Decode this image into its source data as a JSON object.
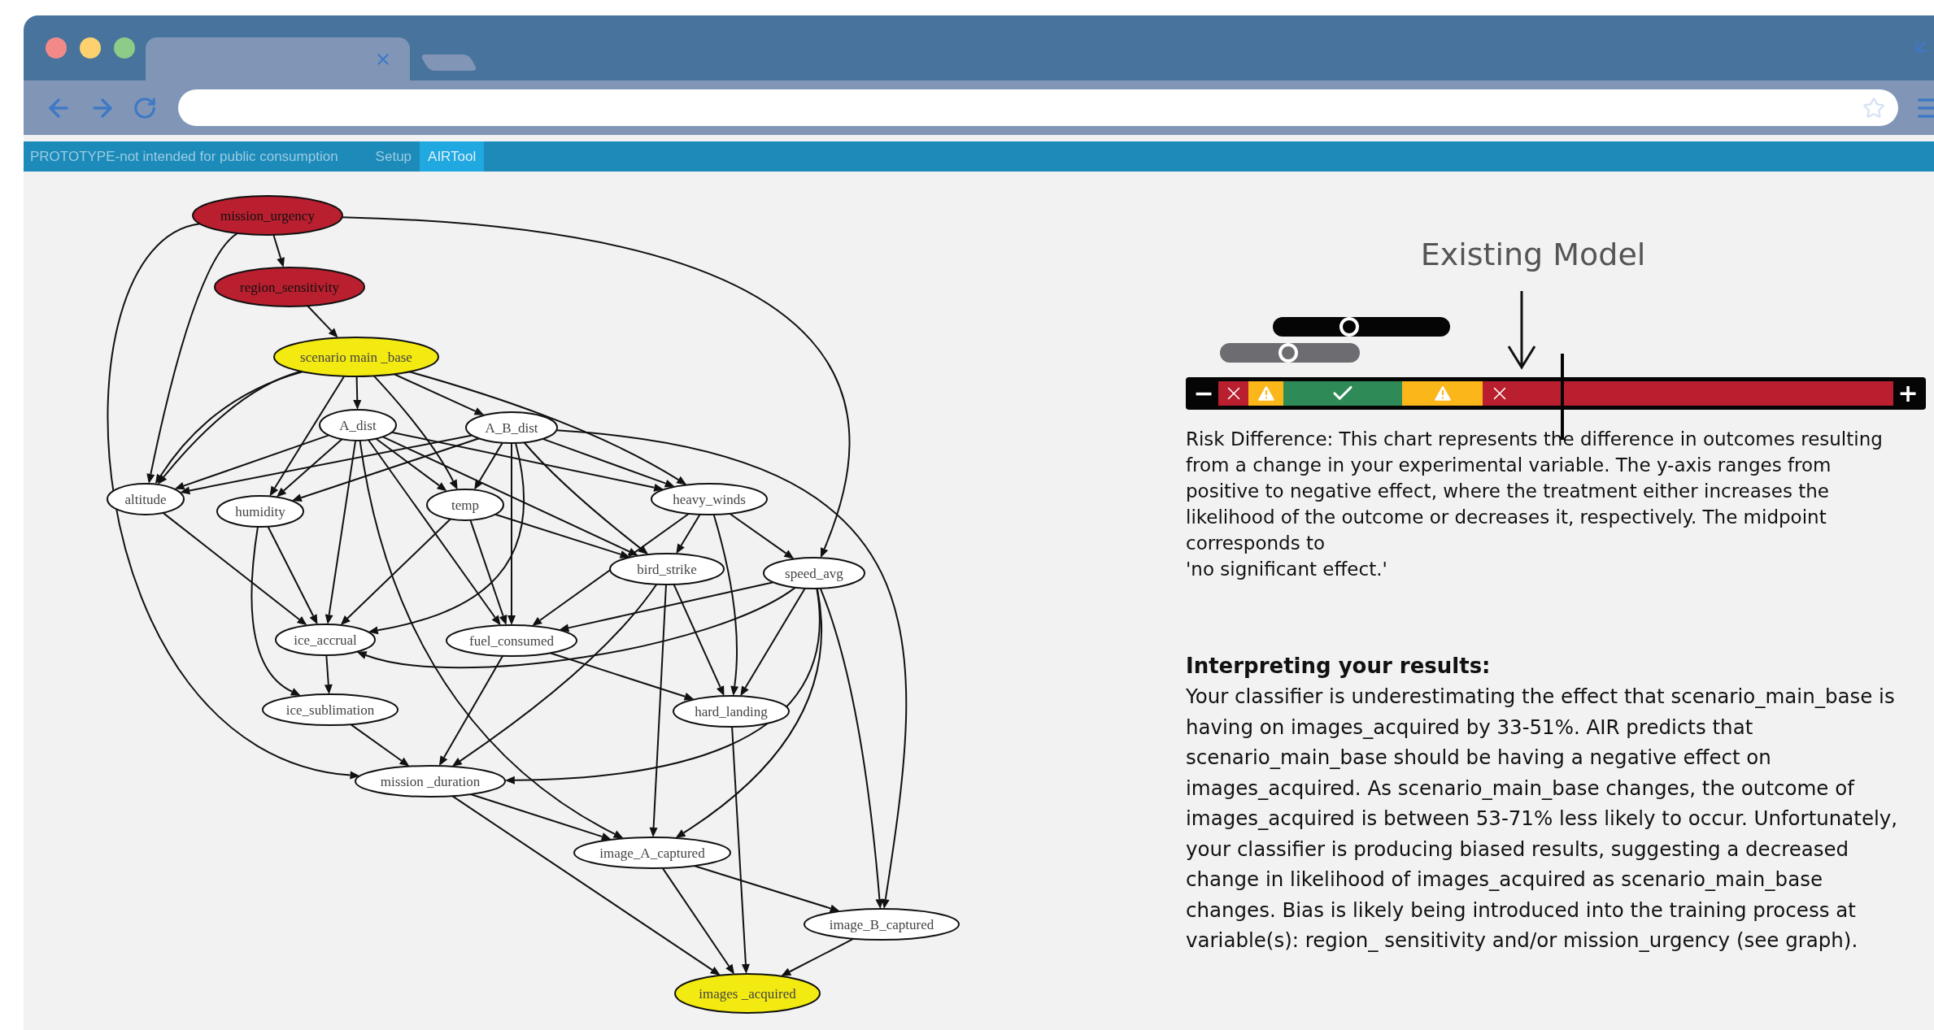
{
  "nav": {
    "notice": "PROTOTYPE-not intended for public consumption",
    "tabs": [
      {
        "label": "Setup",
        "selected": false
      },
      {
        "label": "AIRTool",
        "selected": true
      }
    ]
  },
  "graph": {
    "nodes": [
      {
        "label": "mission_urgency",
        "color": "#b91f2e"
      },
      {
        "label": "region_sensitivity",
        "color": "#b91f2e"
      },
      {
        "label": "scenario main _base",
        "color": "#f3ea12"
      },
      {
        "label": "A_dist",
        "color": "#ffffff"
      },
      {
        "label": "A_B_dist",
        "color": "#ffffff"
      },
      {
        "label": "altitude",
        "color": "#ffffff"
      },
      {
        "label": "humidity",
        "color": "#ffffff"
      },
      {
        "label": "temp",
        "color": "#ffffff"
      },
      {
        "label": "heavy_winds",
        "color": "#ffffff"
      },
      {
        "label": "bird_strike",
        "color": "#ffffff"
      },
      {
        "label": "speed_avg",
        "color": "#ffffff"
      },
      {
        "label": "ice_accrual",
        "color": "#ffffff"
      },
      {
        "label": "fuel_consumed",
        "color": "#ffffff"
      },
      {
        "label": "ice_sublimation",
        "color": "#ffffff"
      },
      {
        "label": "hard_landing",
        "color": "#ffffff"
      },
      {
        "label": "mission _duration",
        "color": "#ffffff"
      },
      {
        "label": "image_A_captured",
        "color": "#ffffff"
      },
      {
        "label": "image_B_captured",
        "color": "#ffffff"
      },
      {
        "label": "images _acquired",
        "color": "#f3ea12"
      }
    ]
  },
  "model": {
    "title": "Existing Model",
    "sliders": [
      {
        "kind": "dark",
        "level": 0.43
      },
      {
        "kind": "gray",
        "level": 0.49
      }
    ],
    "risk_bar": {
      "zoom_out": "−",
      "zoom_in": "+",
      "segments": [
        {
          "kind": "fail",
          "color": "#b91f2e"
        },
        {
          "kind": "warn",
          "color": "#fbb61a"
        },
        {
          "kind": "ok",
          "color": "#2e8b57"
        },
        {
          "kind": "warn",
          "color": "#fbb61a"
        },
        {
          "kind": "fail",
          "color": "#b91f2e"
        }
      ]
    },
    "description": "Risk Difference: This chart represents the difference in outcomes resulting from a change in your experimental variable. The y-axis ranges from positive to negative effect, where the treatment either increases the likelihood of the outcome or decreases it, respectively. The midpoint corresponds to\n'no significant effect.'",
    "interpretation": {
      "heading": "Interpreting your results:",
      "body": "Your classifier is underestimating the effect that scenario_main_base is having on images_acquired by 33-51%. AIR predicts that scenario_main_base should be having a negative effect on images_acquired. As scenario_main_base changes, the outcome of images_acquired is between 53-71% less likely to occur. Unfortunately, your classifier is producing biased results, suggesting a decreased change in likelihood of images_acquired as scenario_main_base changes. Bias is likely being introduced into the training process at variable(s): region_ sensitivity and/or mission_urgency (see graph)."
    }
  }
}
